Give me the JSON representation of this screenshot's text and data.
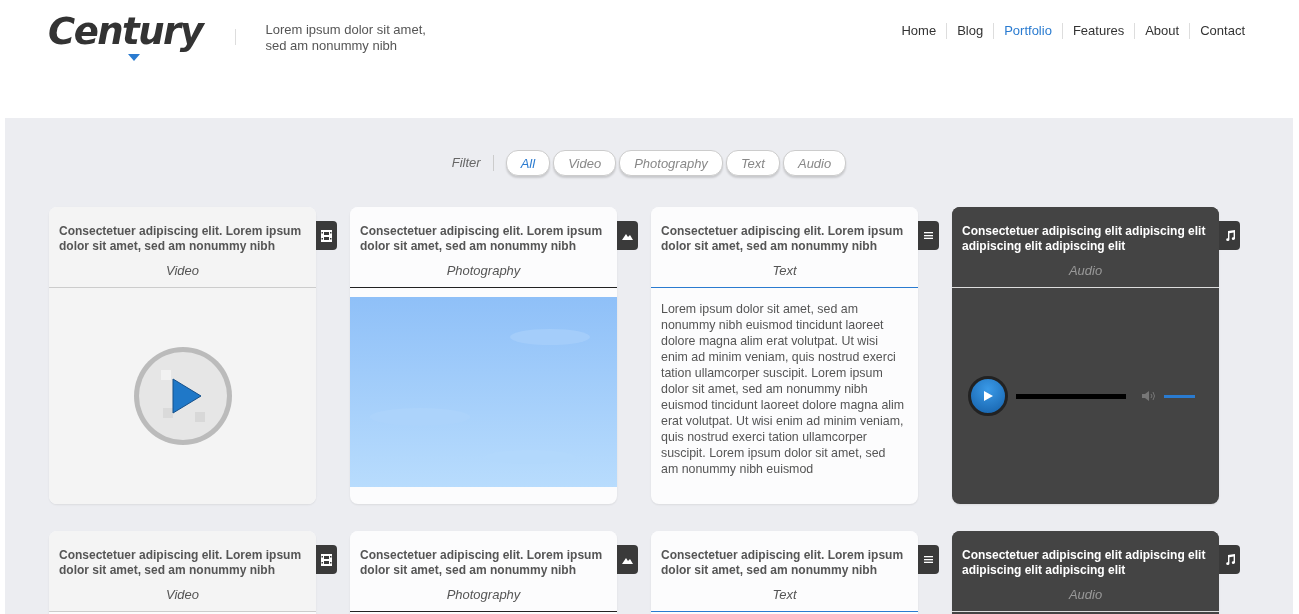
{
  "logo": {
    "text": "Century"
  },
  "tagline": "Lorem ipsum dolor sit amet,\nsed am nonummy nibh",
  "nav": [
    {
      "label": "Home",
      "selected": false
    },
    {
      "label": "Blog",
      "selected": false
    },
    {
      "label": "Portfolio",
      "selected": true
    },
    {
      "label": "Features",
      "selected": false
    },
    {
      "label": "About",
      "selected": false
    },
    {
      "label": "Contact",
      "selected": false
    }
  ],
  "filter": {
    "label": "Filter",
    "options": [
      {
        "label": "All",
        "selected": true
      },
      {
        "label": "Video",
        "selected": false
      },
      {
        "label": "Photography",
        "selected": false
      },
      {
        "label": "Text",
        "selected": false
      },
      {
        "label": "Audio",
        "selected": false
      }
    ]
  },
  "cards": [
    {
      "kind": "video",
      "title": "Consectetuer adipiscing elit. Lorem ipsum dolor sit amet, sed am nonummy nibh",
      "category": "Video"
    },
    {
      "title": "Consectetuer adipiscing elit. Lorem ipsum dolor sit amet, sed am nonummy nibh",
      "category": "Photography"
    },
    {
      "kind": "text",
      "title": "Consectetuer adipiscing elit. Lorem ipsum dolor sit amet, sed am nonummy nibh",
      "category": "Text",
      "body": "Lorem ipsum dolor sit amet, sed am nonummy nibh euismod tincidunt laoreet dolore magna alim erat volutpat. Ut wisi enim ad minim veniam, quis nostrud exerci tation ullamcorper suscipit. Lorem ipsum dolor sit amet, sed am nonummy nibh euismod tincidunt laoreet dolore magna alim erat volutpat. Ut wisi enim ad minim veniam, quis nostrud exerci tation ullamcorper suscipit. Lorem ipsum dolor sit amet, sed am nonummy nibh euismod"
    },
    {
      "kind": "audio",
      "title": "Consectetuer adipiscing elit adipiscing elit adipiscing elit adipiscing elit",
      "category": "Audio",
      "progress": {
        "level": 0
      },
      "volume": {
        "level": 1
      }
    },
    {
      "kind": "video",
      "title": "Consectetuer adipiscing elit. Lorem ipsum dolor sit amet, sed am nonummy nibh",
      "category": "Video"
    },
    {
      "title": "Consectetuer adipiscing elit. Lorem ipsum dolor sit amet, sed am nonummy nibh",
      "category": "Photography"
    },
    {
      "kind": "text",
      "title": "Consectetuer adipiscing elit. Lorem ipsum dolor sit amet, sed am nonummy nibh",
      "category": "Text"
    },
    {
      "kind": "audio",
      "title": "Consectetuer adipiscing elit adipiscing elit adipiscing elit adipiscing elit",
      "category": "Audio"
    }
  ]
}
